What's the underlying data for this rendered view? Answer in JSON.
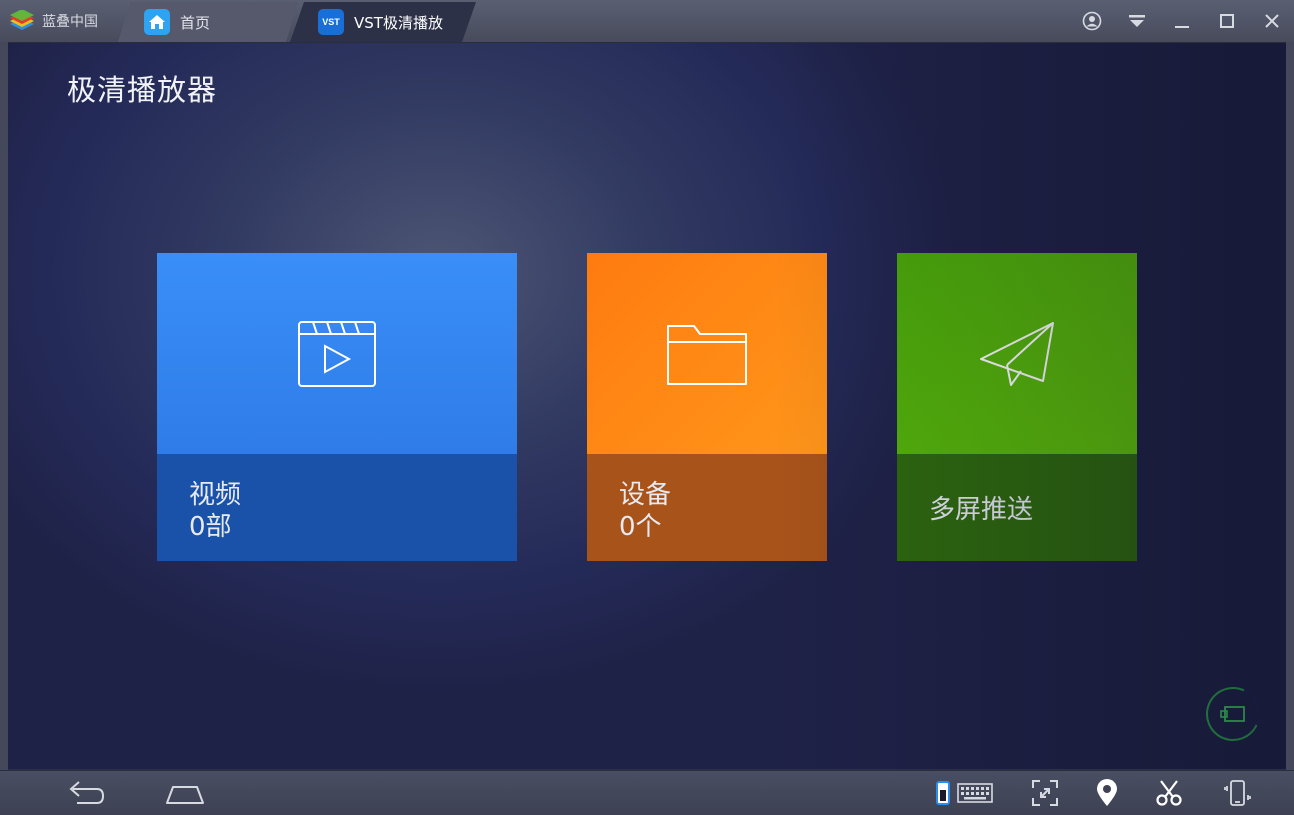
{
  "titlebar": {
    "brand_label": "蓝叠中国",
    "tabs": [
      {
        "label": "首页",
        "icon": "home-icon"
      },
      {
        "label": "VST极清播放",
        "icon": "vst-app-icon",
        "icon_text": "VST"
      }
    ],
    "controls": [
      "account-icon",
      "dropdown-icon",
      "minimize-icon",
      "maximize-icon",
      "close-icon"
    ]
  },
  "main": {
    "title": "极清播放器",
    "tiles": [
      {
        "icon": "video-clapper-icon",
        "label": "视频",
        "count": "0部",
        "color": "#3a8ef7"
      },
      {
        "icon": "folder-icon",
        "label": "设备",
        "count": "0个",
        "color": "#ff8a14"
      },
      {
        "icon": "paper-plane-icon",
        "label": "多屏推送",
        "color": "#55b80a"
      }
    ]
  },
  "bottombar": {
    "left": [
      "back-icon",
      "home-outline-icon"
    ],
    "right": [
      "keyboard-icon",
      "fullscreen-icon",
      "location-icon",
      "scissors-icon",
      "shake-icon"
    ]
  }
}
